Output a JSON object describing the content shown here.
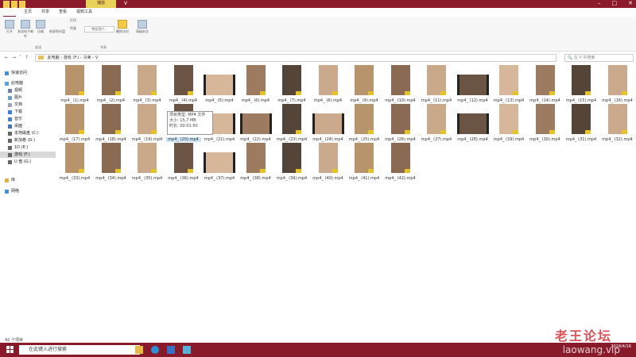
{
  "window": {
    "tool_tab": "播放",
    "title": "V"
  },
  "menu": {
    "file": "文件",
    "file_key": "F",
    "home": "主页",
    "home_key": "H",
    "share": "共享",
    "share_key": "S",
    "view": "查看",
    "view_key": "V",
    "video_tools": "视频工具",
    "video_tools_key": "JV"
  },
  "ribbon": {
    "items": [
      "打开",
      "发送电子邮件",
      "压缩",
      "刻录到光盘",
      "传真",
      "打印",
      "特定用户...",
      "删除访问",
      "高级安全"
    ],
    "groups": [
      "发送",
      "共享"
    ]
  },
  "address": {
    "path": [
      "此电脑",
      "游戏 (F:)",
      "冷束",
      "V"
    ],
    "search_placeholder": "在 V 中搜索"
  },
  "nav": {
    "items": [
      "快速访问",
      "此电脑",
      "视频",
      "图片",
      "文档",
      "下载",
      "音乐",
      "桌面",
      "本地磁盘 (C:)",
      "新加卷 (D:)",
      "1D (E:)",
      "游戏 (F:)",
      "U 盘 (G:)",
      "库",
      "网络"
    ]
  },
  "files": [
    "mp4_ (1).mp4",
    "mp4_ (2).mp4",
    "mp4_ (3).mp4",
    "mp4_ (4).mp4",
    "mp4_ (5).mp4",
    "mp4_ (6).mp4",
    "mp4_ (7).mp4",
    "mp4_ (8).mp4",
    "mp4_ (9).mp4",
    "mp4_ (10).mp4",
    "mp4_ (11).mp4",
    "mp4_ (12).mp4",
    "mp4_ (13).mp4",
    "mp4_ (14).mp4",
    "mp4_ (15).mp4",
    "mp4_ (16).mp4",
    "mp4_ (17).mp4",
    "mp4_ (18).mp4",
    "mp4_ (19).mp4",
    "mp4_ (20).mp4",
    "mp4_ (21).mp4",
    "mp4_ (22).mp4",
    "mp4_ (23).mp4",
    "mp4_ (24).mp4",
    "mp4_ (25).mp4",
    "mp4_ (26).mp4",
    "mp4_ (27).mp4",
    "mp4_ (28).mp4",
    "mp4_ (29).mp4",
    "mp4_ (30).mp4",
    "mp4_ (31).mp4",
    "mp4_ (32).mp4",
    "mp4_ (33).mp4",
    "mp4_ (34).mp4",
    "mp4_ (35).mp4",
    "mp4_ (36).mp4",
    "mp4_ (37).mp4",
    "mp4_ (38).mp4",
    "mp4_ (39).mp4",
    "mp4_ (40).mp4",
    "mp4_ (41).mp4",
    "mp4_ (42).mp4"
  ],
  "tooltip": {
    "type": "项目类型: MP4 文件",
    "size": "大小: 15.7 MB",
    "duration": "时长: 00:01:50"
  },
  "status": "42 个项目",
  "taskbar": {
    "search_placeholder": "在此键入进行搜索",
    "date": "2024/4/16"
  },
  "watermark": {
    "line1": "老王论坛",
    "line2": "laowang.vip"
  },
  "colors": {
    "titlebar": "#8b1a2b",
    "taskbar": "#881a2a",
    "tool_tab": "#e8d25a"
  }
}
